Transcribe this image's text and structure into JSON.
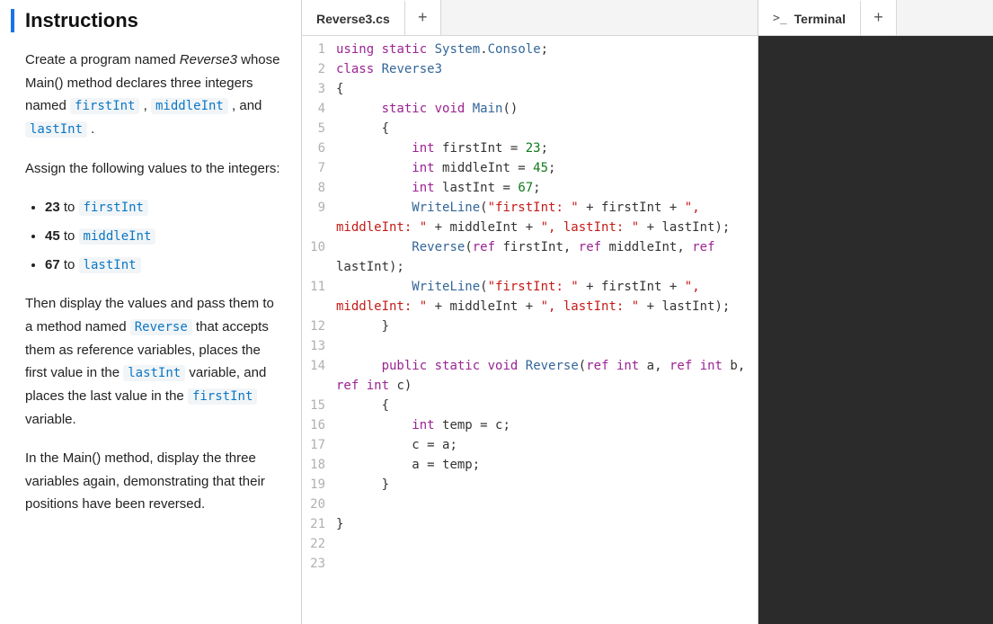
{
  "instructions": {
    "title": "Instructions",
    "p1_prefix": "Create a program named ",
    "p1_program": "Reverse3",
    "p1_mid": " whose Main() method declares three integers named ",
    "tok_firstInt": "firstInt",
    "tok_middleInt": "middleInt",
    "tok_lastInt": "lastInt",
    "p1_sep": " , ",
    "p1_and": " , and ",
    "p1_end": " .",
    "p2": "Assign the following values to the integers:",
    "bullets": [
      {
        "val": "23",
        "mid": " to ",
        "tok": "firstInt"
      },
      {
        "val": "45",
        "mid": " to ",
        "tok": "middleInt"
      },
      {
        "val": "67",
        "mid": " to ",
        "tok": "lastInt"
      }
    ],
    "p3_a": "Then display the values and pass them to a method named ",
    "p3_tok": "Reverse",
    "p3_b": " that accepts them as reference variables, places the first value in the ",
    "p3_tok2": "lastInt",
    "p3_c": " variable, and places the last value in the ",
    "p3_tok3": "firstInt",
    "p3_d": " variable.",
    "p4": "In the Main() method, display the three variables again, demonstrating that their positions have been reversed."
  },
  "editor": {
    "tab": "Reverse3.cs",
    "plus": "+",
    "code": [
      {
        "n": "1",
        "h": "<span class='kw'>using</span> <span class='kw'>static</span> <span class='fn'>System</span>.<span class='fn'>Console</span>;"
      },
      {
        "n": "2",
        "h": "<span class='kw'>class</span> <span class='id'>Reverse3</span>"
      },
      {
        "n": "3",
        "h": "{"
      },
      {
        "n": "4",
        "h": "      <span class='kw'>static</span> <span class='kw'>void</span> <span class='fn'>Main</span>()"
      },
      {
        "n": "5",
        "h": "      {"
      },
      {
        "n": "6",
        "h": "          <span class='ty'>int</span> firstInt = <span class='nm'>23</span>;"
      },
      {
        "n": "7",
        "h": "          <span class='ty'>int</span> middleInt = <span class='nm'>45</span>;"
      },
      {
        "n": "8",
        "h": "          <span class='ty'>int</span> lastInt = <span class='nm'>67</span>;"
      },
      {
        "n": "9",
        "h": "          <span class='fn'>WriteLine</span>(<span class='st'>\"firstInt: \"</span> + firstInt + <span class='st'>\", middleInt: \"</span> + middleInt + <span class='st'>\", lastInt: \"</span> + lastInt);"
      },
      {
        "n": "10",
        "h": "          <span class='fn'>Reverse</span>(<span class='kw'>ref</span> firstInt, <span class='kw'>ref</span> middleInt, <span class='kw'>ref</span> lastInt);"
      },
      {
        "n": "11",
        "h": "          <span class='fn'>WriteLine</span>(<span class='st'>\"firstInt: \"</span> + firstInt + <span class='st'>\", middleInt: \"</span> + middleInt + <span class='st'>\", lastInt: \"</span> + lastInt);"
      },
      {
        "n": "12",
        "h": "      }"
      },
      {
        "n": "13",
        "h": ""
      },
      {
        "n": "14",
        "h": "      <span class='kw'>public</span> <span class='kw'>static</span> <span class='kw'>void</span> <span class='fn'>Reverse</span>(<span class='kw'>ref</span> <span class='ty'>int</span> a, <span class='kw'>ref</span> <span class='ty'>int</span> b, <span class='kw'>ref</span> <span class='ty'>int</span> c)"
      },
      {
        "n": "15",
        "h": "      {"
      },
      {
        "n": "16",
        "h": "          <span class='ty'>int</span> temp = c;"
      },
      {
        "n": "17",
        "h": "          c = a;"
      },
      {
        "n": "18",
        "h": "          a = temp;"
      },
      {
        "n": "19",
        "h": "      }"
      },
      {
        "n": "20",
        "h": ""
      },
      {
        "n": "21",
        "h": "}"
      },
      {
        "n": "22",
        "h": ""
      },
      {
        "n": "23",
        "h": ""
      }
    ]
  },
  "terminal": {
    "prefix": ">_",
    "label": "Terminal",
    "plus": "+"
  }
}
